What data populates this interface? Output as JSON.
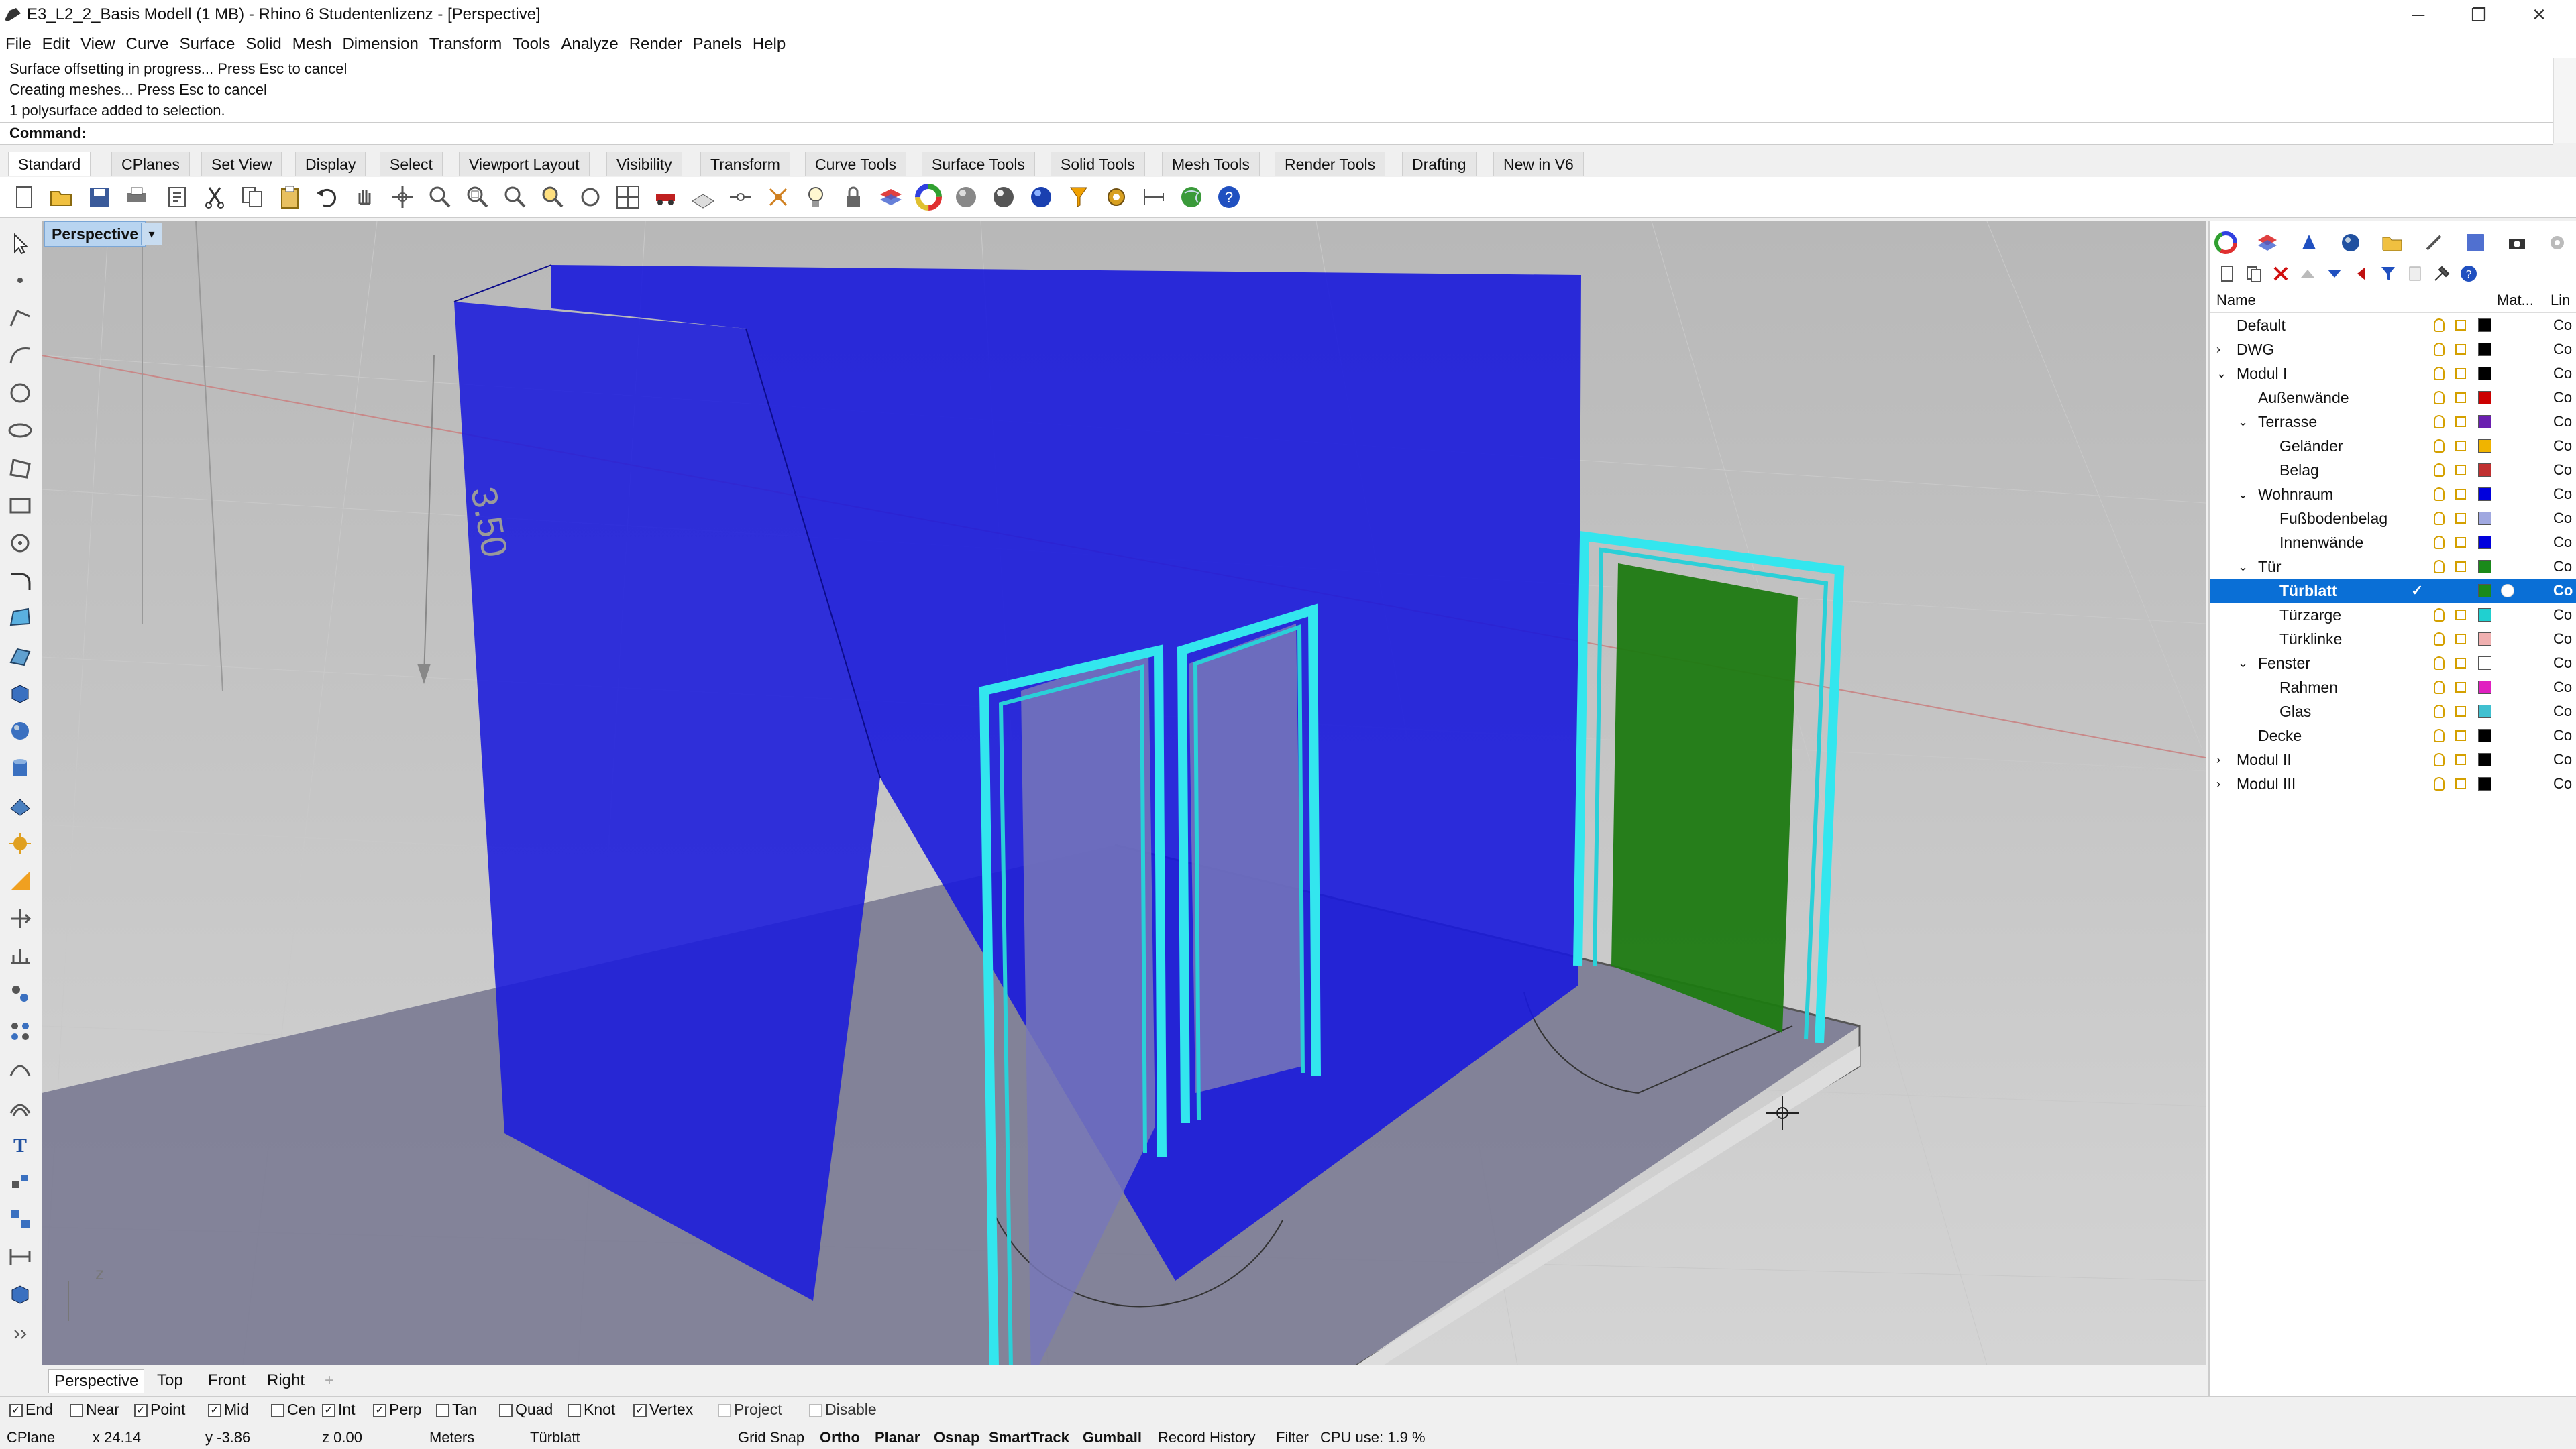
{
  "window": {
    "title": "E3_L2_2_Basis Modell (1 MB) - Rhino 6 Studentenlizenz - [Perspective]",
    "controls": [
      "─",
      "❐",
      "✕"
    ]
  },
  "menu": [
    "File",
    "Edit",
    "View",
    "Curve",
    "Surface",
    "Solid",
    "Mesh",
    "Dimension",
    "Transform",
    "Tools",
    "Analyze",
    "Render",
    "Panels",
    "Help"
  ],
  "command": {
    "history": [
      "Surface offsetting in progress... Press Esc to cancel",
      "Creating meshes... Press Esc to cancel",
      "1 polysurface added to selection."
    ],
    "prompt": "Command:"
  },
  "toolbar_tabs": [
    "Standard",
    "CPlanes",
    "Set View",
    "Display",
    "Select",
    "Viewport Layout",
    "Visibility",
    "Transform",
    "Curve Tools",
    "Surface Tools",
    "Solid Tools",
    "Mesh Tools",
    "Render Tools",
    "Drafting",
    "New in V6"
  ],
  "viewport": {
    "label": "Perspective",
    "dimension_text": "3.50",
    "axis_label": "z"
  },
  "viewport_tabs": [
    "Perspective",
    "Top",
    "Front",
    "Right",
    "+"
  ],
  "layers_panel": {
    "col_name": "Name",
    "col_material": "Mat...",
    "col_linetype": "Lin",
    "rows": [
      {
        "name": "Default",
        "indent": 0,
        "toggle": "",
        "color": "#000000",
        "line": "Co",
        "selected": false
      },
      {
        "name": "DWG",
        "indent": 0,
        "toggle": "›",
        "color": "#000000",
        "line": "Co",
        "selected": false
      },
      {
        "name": "Modul I",
        "indent": 0,
        "toggle": "⌄",
        "color": "#000000",
        "line": "Co",
        "selected": false
      },
      {
        "name": "Außenwände",
        "indent": 1,
        "toggle": "",
        "color": "#cc0000",
        "line": "Co",
        "selected": false
      },
      {
        "name": "Terrasse",
        "indent": 1,
        "toggle": "⌄",
        "color": "#6a1fb0",
        "line": "Co",
        "selected": false
      },
      {
        "name": "Geländer",
        "indent": 2,
        "toggle": "",
        "color": "#f0b400",
        "line": "Co",
        "selected": false
      },
      {
        "name": "Belag",
        "indent": 2,
        "toggle": "",
        "color": "#c03030",
        "line": "Co",
        "selected": false
      },
      {
        "name": "Wohnraum",
        "indent": 1,
        "toggle": "⌄",
        "color": "#0000dd",
        "line": "Co",
        "selected": false
      },
      {
        "name": "Fußbodenbelag",
        "indent": 2,
        "toggle": "",
        "color": "#a0a8e0",
        "line": "Co",
        "selected": false
      },
      {
        "name": "Innenwände",
        "indent": 2,
        "toggle": "",
        "color": "#0000dd",
        "line": "Co",
        "selected": false
      },
      {
        "name": "Tür",
        "indent": 1,
        "toggle": "⌄",
        "color": "#1a8a1a",
        "line": "Co",
        "selected": false
      },
      {
        "name": "Türblatt",
        "indent": 2,
        "toggle": "",
        "color": "#1a8a1a",
        "line": "Co",
        "selected": true
      },
      {
        "name": "Türzarge",
        "indent": 2,
        "toggle": "",
        "color": "#20d0d0",
        "line": "Co",
        "selected": false
      },
      {
        "name": "Türklinke",
        "indent": 2,
        "toggle": "",
        "color": "#f0b0b0",
        "line": "Co",
        "selected": false
      },
      {
        "name": "Fenster",
        "indent": 1,
        "toggle": "⌄",
        "color": "#ffffff",
        "line": "Co",
        "selected": false
      },
      {
        "name": "Rahmen",
        "indent": 2,
        "toggle": "",
        "color": "#e020c0",
        "line": "Co",
        "selected": false
      },
      {
        "name": "Glas",
        "indent": 2,
        "toggle": "",
        "color": "#40c0d0",
        "line": "Co",
        "selected": false
      },
      {
        "name": "Decke",
        "indent": 1,
        "toggle": "",
        "color": "#000000",
        "line": "Co",
        "selected": false
      },
      {
        "name": "Modul II",
        "indent": 0,
        "toggle": "›",
        "color": "#000000",
        "line": "Co",
        "selected": false
      },
      {
        "name": "Modul III",
        "indent": 0,
        "toggle": "›",
        "color": "#000000",
        "line": "Co",
        "selected": false
      }
    ]
  },
  "osnaps": [
    {
      "label": "End",
      "checked": true
    },
    {
      "label": "Near",
      "checked": false
    },
    {
      "label": "Point",
      "checked": true
    },
    {
      "label": "Mid",
      "checked": true
    },
    {
      "label": "Cen",
      "checked": false
    },
    {
      "label": "Int",
      "checked": true
    },
    {
      "label": "Perp",
      "checked": true
    },
    {
      "label": "Tan",
      "checked": false
    },
    {
      "label": "Quad",
      "checked": false
    },
    {
      "label": "Knot",
      "checked": false
    },
    {
      "label": "Vertex",
      "checked": true
    },
    {
      "label": "Project",
      "checked": false
    },
    {
      "label": "Disable",
      "checked": false
    }
  ],
  "status": {
    "cplane": "CPlane",
    "x": "x 24.14",
    "y": "y -3.86",
    "z": "z 0.00",
    "units": "Meters",
    "layer": "Türblatt",
    "grid_snap": "Grid Snap",
    "ortho": "Ortho",
    "planar": "Planar",
    "osnap": "Osnap",
    "smarttrack": "SmartTrack",
    "gumball": "Gumball",
    "record_history": "Record History",
    "filter": "Filter",
    "cpu": "CPU use: 1.9 %"
  },
  "colors": {
    "wall_blue": "#1a1adc",
    "frame_cyan": "#33e6ee",
    "door_green": "#1e7a12",
    "selection": "#0a6fd6"
  }
}
